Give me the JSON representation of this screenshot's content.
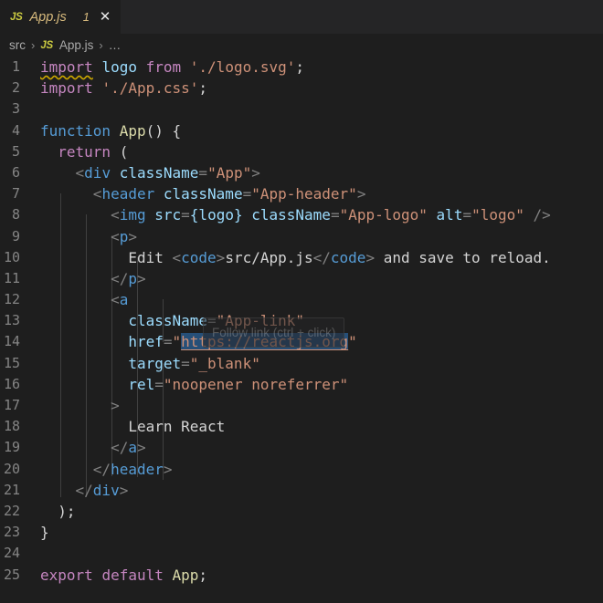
{
  "window": {
    "app": "vscode",
    "theme": "dark-plus",
    "colors": {
      "editor_background": "#1e1e1e",
      "tabbar_background": "#252526",
      "line_number": "#858585",
      "keyword": "#c586c0",
      "control": "#569cd6",
      "variable": "#9cdcfe",
      "string": "#ce9178",
      "function": "#dcdcaa",
      "punctuation": "#808080",
      "text": "#d4d4d4",
      "warning_squiggle": "#cca700",
      "link_selection": "#264f78",
      "tab_modified_label": "#d7ba7d",
      "js_icon": "#cbcb41"
    }
  },
  "tab": {
    "icon_label": "JS",
    "filename": "App.js",
    "badge": "1",
    "close_glyph": "✕"
  },
  "breadcrumb": {
    "folder": "src",
    "separator": "›",
    "file_icon": "JS",
    "file": "App.js",
    "ellipsis": "…"
  },
  "tooltip": {
    "text": "Follow link (ctrl + click)"
  },
  "editor": {
    "line_numbers": [
      "1",
      "2",
      "3",
      "4",
      "5",
      "6",
      "7",
      "8",
      "9",
      "10",
      "11",
      "12",
      "13",
      "14",
      "15",
      "16",
      "17",
      "18",
      "19",
      "20",
      "21",
      "22",
      "23",
      "24",
      "25"
    ],
    "lines": [
      {
        "n": "1",
        "text": "import logo from './logo.svg';"
      },
      {
        "n": "2",
        "text": "import './App.css';"
      },
      {
        "n": "3",
        "text": ""
      },
      {
        "n": "4",
        "text": "function App() {"
      },
      {
        "n": "5",
        "text": "  return ("
      },
      {
        "n": "6",
        "text": "    <div className=\"App\">"
      },
      {
        "n": "7",
        "text": "      <header className=\"App-header\">"
      },
      {
        "n": "8",
        "text": "        <img src={logo} className=\"App-logo\" alt=\"logo\" />"
      },
      {
        "n": "9",
        "text": "        <p>"
      },
      {
        "n": "10",
        "text": "          Edit <code>src/App.js</code> and save to reload."
      },
      {
        "n": "11",
        "text": "        </p>"
      },
      {
        "n": "12",
        "text": "        <a"
      },
      {
        "n": "13",
        "text": "          className=\"App-link\""
      },
      {
        "n": "14",
        "text": "          href=\"https://reactjs.org\""
      },
      {
        "n": "15",
        "text": "          target=\"_blank\""
      },
      {
        "n": "16",
        "text": "          rel=\"noopener noreferrer\""
      },
      {
        "n": "17",
        "text": "        >"
      },
      {
        "n": "18",
        "text": "          Learn React"
      },
      {
        "n": "19",
        "text": "        </a>"
      },
      {
        "n": "20",
        "text": "      </header>"
      },
      {
        "n": "21",
        "text": "    </div>"
      },
      {
        "n": "22",
        "text": "  );"
      },
      {
        "n": "23",
        "text": "}"
      },
      {
        "n": "24",
        "text": ""
      },
      {
        "n": "25",
        "text": "export default App;"
      }
    ],
    "tokens": {
      "l1": {
        "kw_import": "import",
        "ident": "logo",
        "kw_from": "from",
        "str": "'./logo.svg'",
        "semi": ";"
      },
      "l2": {
        "kw_import": "import",
        "str": "'./App.css'",
        "semi": ";"
      },
      "l4": {
        "kw": "function",
        "name": "App",
        "parens": "()",
        "brace": "{"
      },
      "l5": {
        "kw": "return",
        "paren": "("
      },
      "l6": {
        "lt": "<",
        "tag": "div",
        "attr": "className",
        "eq": "=",
        "val": "\"App\"",
        "gt": ">"
      },
      "l7": {
        "lt": "<",
        "tag": "header",
        "attr": "className",
        "eq": "=",
        "val": "\"App-header\"",
        "gt": ">"
      },
      "l8": {
        "lt": "<",
        "tag": "img",
        "attr1": "src",
        "expr": "{logo}",
        "attr2": "className",
        "val2": "\"App-logo\"",
        "attr3": "alt",
        "val3": "\"logo\"",
        "close": "/>"
      },
      "l9": {
        "lt": "<",
        "tag": "p",
        "gt": ">"
      },
      "l10": {
        "text1": "Edit ",
        "open": "<code>",
        "code": "src/App.js",
        "closetag": "</code>",
        "text2": " and save to reload."
      },
      "l11": {
        "close": "</p>"
      },
      "l12": {
        "lt": "<",
        "tag": "a"
      },
      "l13": {
        "attr": "className",
        "eq": "=",
        "val": "\"App-link\""
      },
      "l14": {
        "attr": "href",
        "eq": "=",
        "q1": "\"",
        "url": "https://reactjs.org",
        "q2": "\""
      },
      "l15": {
        "attr": "target",
        "eq": "=",
        "val": "\"_blank\""
      },
      "l16": {
        "attr": "rel",
        "eq": "=",
        "val": "\"noopener noreferrer\""
      },
      "l17": {
        "gt": ">"
      },
      "l18": {
        "text": "Learn React"
      },
      "l19": {
        "close": "</a>"
      },
      "l20": {
        "close": "</header>"
      },
      "l21": {
        "close": "</div>"
      },
      "l22": {
        "text": ");"
      },
      "l23": {
        "text": "}"
      },
      "l25": {
        "kw_export": "export",
        "kw_default": "default",
        "name": "App",
        "semi": ";"
      }
    }
  }
}
